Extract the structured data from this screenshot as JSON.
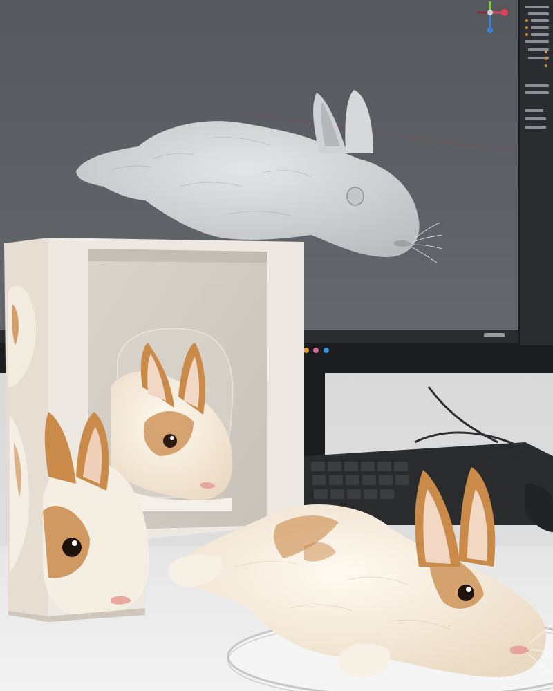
{
  "scene": {
    "subjects": [
      "monitor-showing-3d-rabbit-model",
      "product-box-with-rabbit",
      "plush-rabbit-on-desk",
      "keyboard",
      "turntable"
    ],
    "colors": {
      "viewport_bg": "#5a5d61",
      "sculpt_gray": "#d2d4d6",
      "rabbit_white": "#f6efe3",
      "rabbit_orange": "#c98a4a",
      "box": "#ece7e0",
      "desk": "#ececec",
      "monitor_frame": "#1b1c1e"
    }
  }
}
